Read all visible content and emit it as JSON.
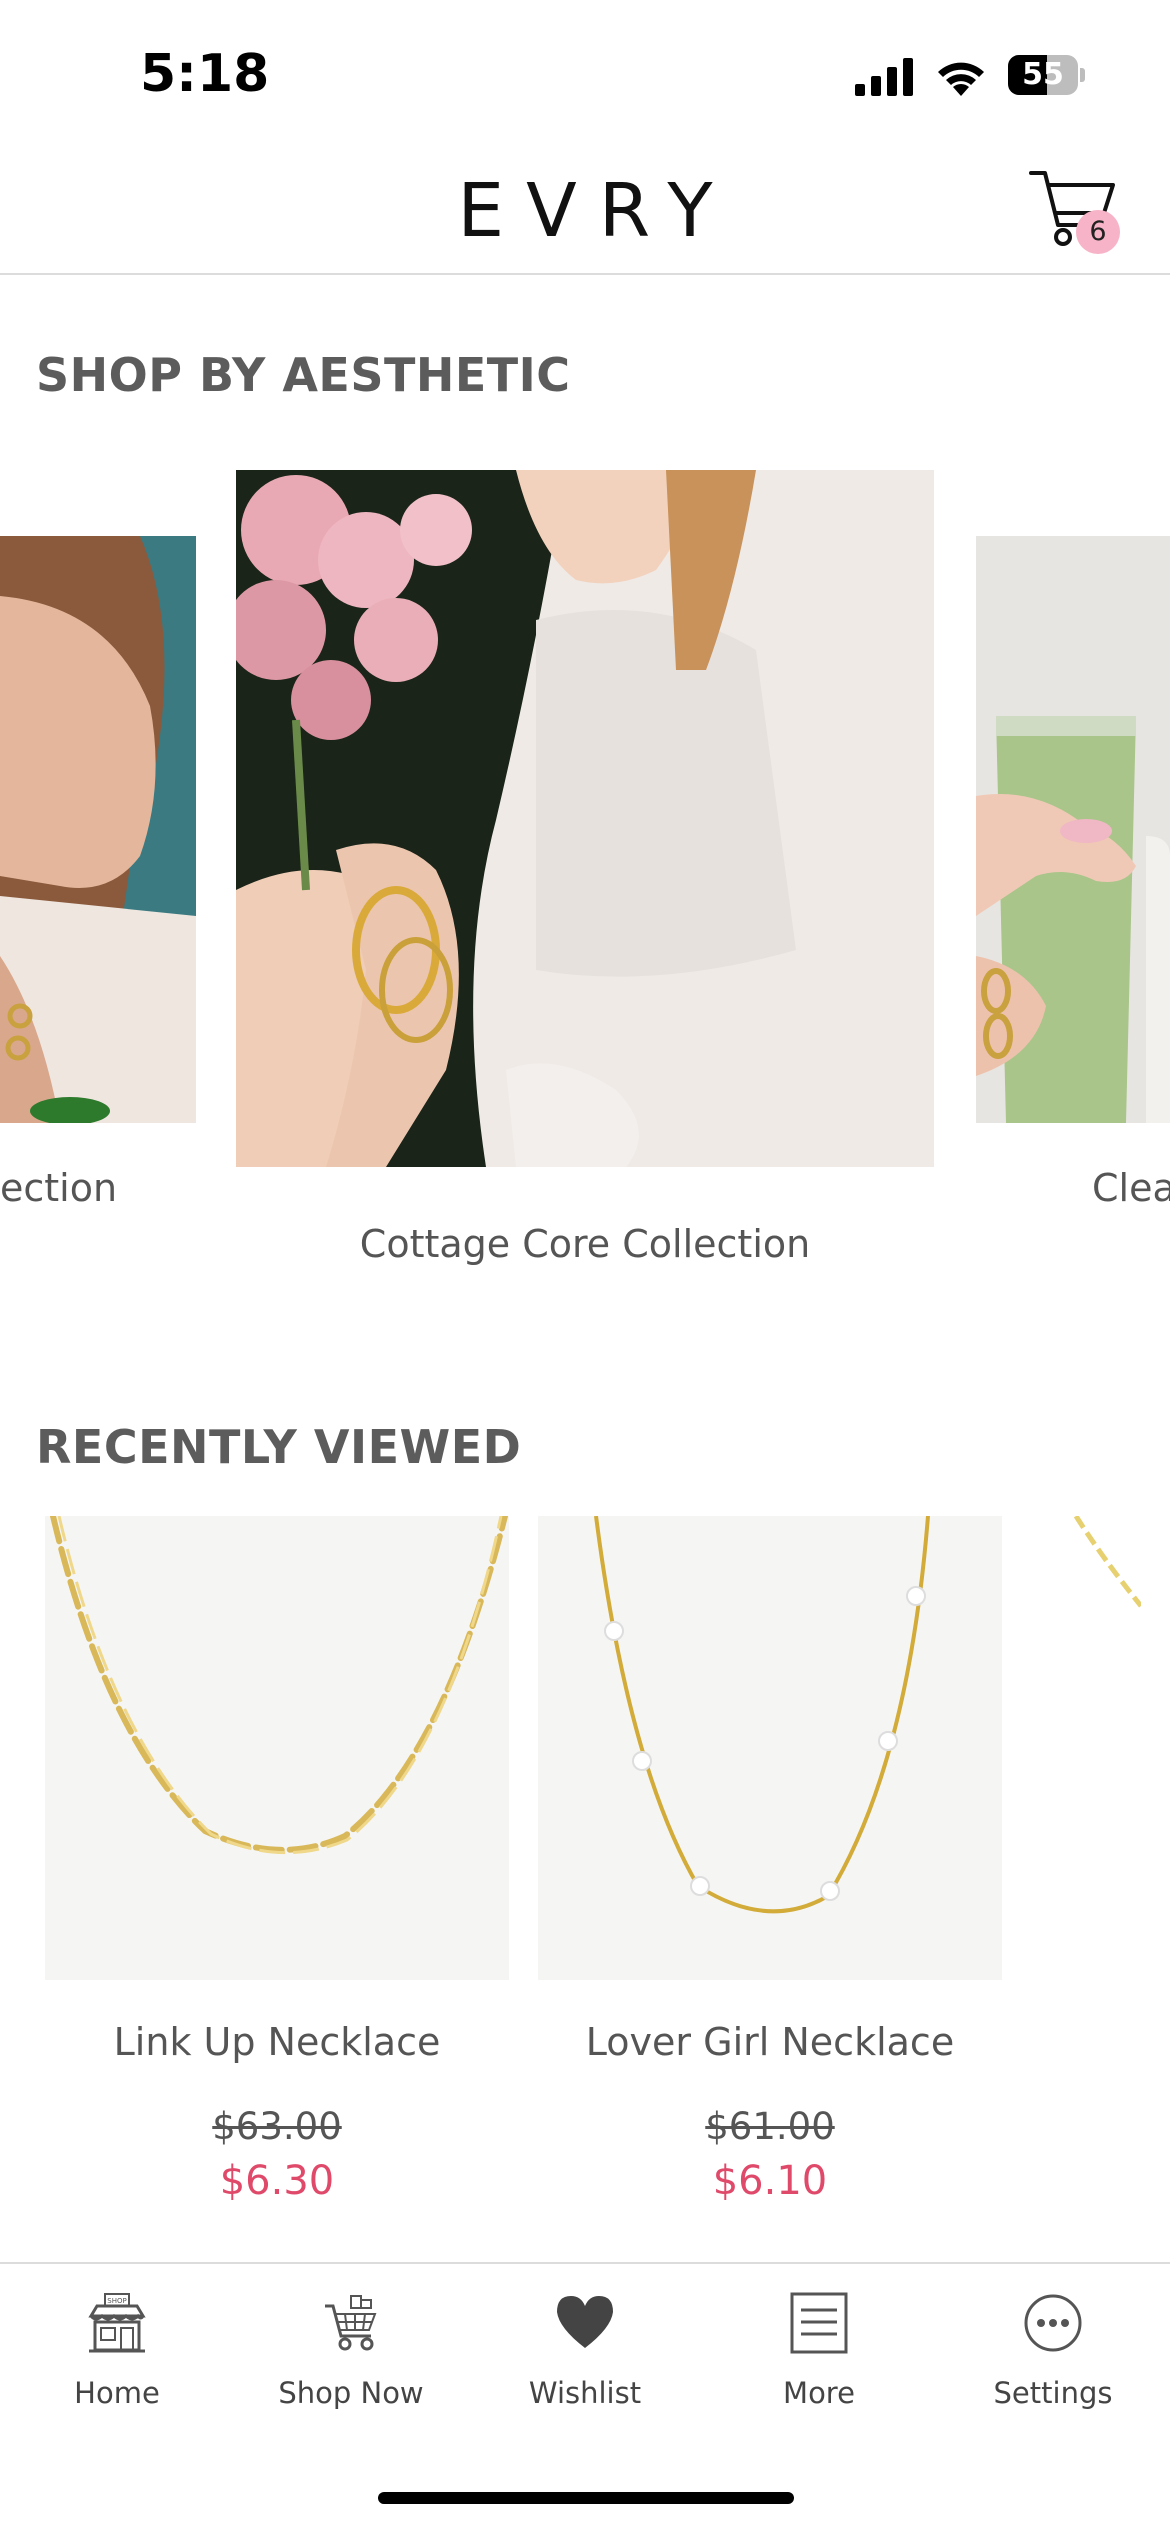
{
  "status_bar": {
    "time": "5:18",
    "battery_level": "55",
    "battery_percent": 55
  },
  "header": {
    "brand": "EVRY",
    "cart_count": "6",
    "cart_icon": "cart-icon"
  },
  "aesthetic": {
    "title": "SHOP BY AESTHETIC",
    "left_label": "ection",
    "center_label": "Cottage Core Collection",
    "right_label": "Clea"
  },
  "recently_viewed": {
    "title": "RECENTLY VIEWED",
    "products": [
      {
        "name": "Link Up Necklace",
        "old_price": "$63.00",
        "price": "$6.30"
      },
      {
        "name": "Lover Girl Necklace",
        "old_price": "$61.00",
        "price": "$6.10"
      }
    ]
  },
  "tabs": [
    {
      "label": "Home",
      "icon": "shop-icon"
    },
    {
      "label": "Shop Now",
      "icon": "shopping-cart-icon"
    },
    {
      "label": "Wishlist",
      "icon": "heart-icon"
    },
    {
      "label": "More",
      "icon": "menu-list-icon"
    },
    {
      "label": "Settings",
      "icon": "more-dots-icon"
    }
  ],
  "colors": {
    "accent_pink": "#f7b3c8",
    "sale_red": "#e04a6a",
    "text_gray": "#555555"
  }
}
